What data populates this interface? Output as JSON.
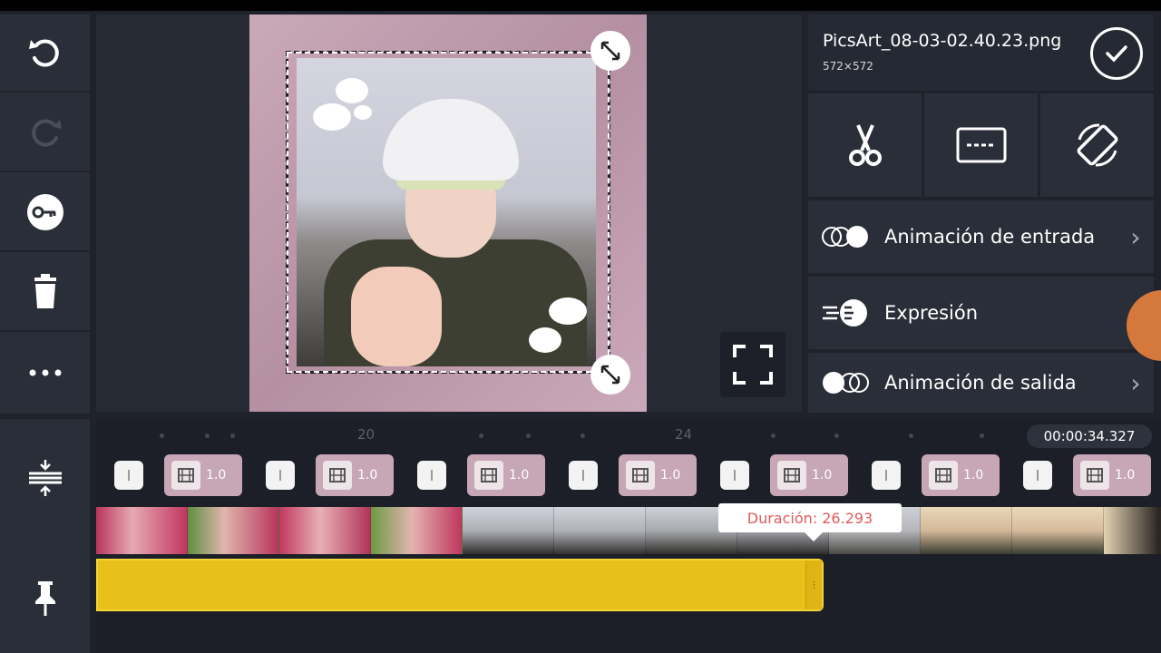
{
  "file": {
    "name": "PicsArt_08-03-02.40.23.png",
    "dimensions": "572×572"
  },
  "menu": {
    "entrada": "Animación de entrada",
    "expresion": "Expresión",
    "salida": "Animación de salida"
  },
  "timeline": {
    "timecode": "00:00:34.327",
    "ruler_numbers": [
      "20",
      "24"
    ],
    "transition_label": "1.0",
    "tooltip": "Duración: 26.293"
  },
  "colors": {
    "accent_audio": "#e8c01a",
    "panel_bg": "#2a2e38",
    "tooltip_text": "#e05a5a"
  },
  "icons": {
    "left_toolbar": [
      "undo-icon",
      "redo-icon",
      "key-icon",
      "trash-icon",
      "more-icon"
    ],
    "timeline_toolbar": [
      "align-vertical-icon",
      "pin-icon"
    ],
    "tools": [
      "scissors-icon",
      "crop-icon",
      "rotate-icon"
    ]
  }
}
